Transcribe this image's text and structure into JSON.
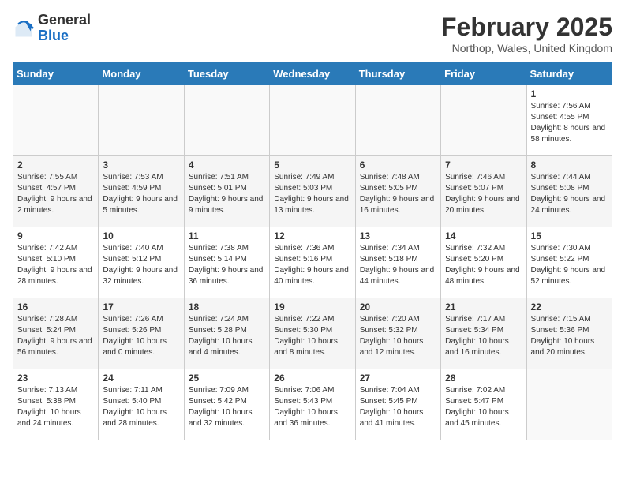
{
  "logo": {
    "general": "General",
    "blue": "Blue"
  },
  "title": "February 2025",
  "subtitle": "Northop, Wales, United Kingdom",
  "days_of_week": [
    "Sunday",
    "Monday",
    "Tuesday",
    "Wednesday",
    "Thursday",
    "Friday",
    "Saturday"
  ],
  "weeks": [
    [
      {
        "day": "",
        "info": ""
      },
      {
        "day": "",
        "info": ""
      },
      {
        "day": "",
        "info": ""
      },
      {
        "day": "",
        "info": ""
      },
      {
        "day": "",
        "info": ""
      },
      {
        "day": "",
        "info": ""
      },
      {
        "day": "1",
        "info": "Sunrise: 7:56 AM\nSunset: 4:55 PM\nDaylight: 8 hours and 58 minutes."
      }
    ],
    [
      {
        "day": "2",
        "info": "Sunrise: 7:55 AM\nSunset: 4:57 PM\nDaylight: 9 hours and 2 minutes."
      },
      {
        "day": "3",
        "info": "Sunrise: 7:53 AM\nSunset: 4:59 PM\nDaylight: 9 hours and 5 minutes."
      },
      {
        "day": "4",
        "info": "Sunrise: 7:51 AM\nSunset: 5:01 PM\nDaylight: 9 hours and 9 minutes."
      },
      {
        "day": "5",
        "info": "Sunrise: 7:49 AM\nSunset: 5:03 PM\nDaylight: 9 hours and 13 minutes."
      },
      {
        "day": "6",
        "info": "Sunrise: 7:48 AM\nSunset: 5:05 PM\nDaylight: 9 hours and 16 minutes."
      },
      {
        "day": "7",
        "info": "Sunrise: 7:46 AM\nSunset: 5:07 PM\nDaylight: 9 hours and 20 minutes."
      },
      {
        "day": "8",
        "info": "Sunrise: 7:44 AM\nSunset: 5:08 PM\nDaylight: 9 hours and 24 minutes."
      }
    ],
    [
      {
        "day": "9",
        "info": "Sunrise: 7:42 AM\nSunset: 5:10 PM\nDaylight: 9 hours and 28 minutes."
      },
      {
        "day": "10",
        "info": "Sunrise: 7:40 AM\nSunset: 5:12 PM\nDaylight: 9 hours and 32 minutes."
      },
      {
        "day": "11",
        "info": "Sunrise: 7:38 AM\nSunset: 5:14 PM\nDaylight: 9 hours and 36 minutes."
      },
      {
        "day": "12",
        "info": "Sunrise: 7:36 AM\nSunset: 5:16 PM\nDaylight: 9 hours and 40 minutes."
      },
      {
        "day": "13",
        "info": "Sunrise: 7:34 AM\nSunset: 5:18 PM\nDaylight: 9 hours and 44 minutes."
      },
      {
        "day": "14",
        "info": "Sunrise: 7:32 AM\nSunset: 5:20 PM\nDaylight: 9 hours and 48 minutes."
      },
      {
        "day": "15",
        "info": "Sunrise: 7:30 AM\nSunset: 5:22 PM\nDaylight: 9 hours and 52 minutes."
      }
    ],
    [
      {
        "day": "16",
        "info": "Sunrise: 7:28 AM\nSunset: 5:24 PM\nDaylight: 9 hours and 56 minutes."
      },
      {
        "day": "17",
        "info": "Sunrise: 7:26 AM\nSunset: 5:26 PM\nDaylight: 10 hours and 0 minutes."
      },
      {
        "day": "18",
        "info": "Sunrise: 7:24 AM\nSunset: 5:28 PM\nDaylight: 10 hours and 4 minutes."
      },
      {
        "day": "19",
        "info": "Sunrise: 7:22 AM\nSunset: 5:30 PM\nDaylight: 10 hours and 8 minutes."
      },
      {
        "day": "20",
        "info": "Sunrise: 7:20 AM\nSunset: 5:32 PM\nDaylight: 10 hours and 12 minutes."
      },
      {
        "day": "21",
        "info": "Sunrise: 7:17 AM\nSunset: 5:34 PM\nDaylight: 10 hours and 16 minutes."
      },
      {
        "day": "22",
        "info": "Sunrise: 7:15 AM\nSunset: 5:36 PM\nDaylight: 10 hours and 20 minutes."
      }
    ],
    [
      {
        "day": "23",
        "info": "Sunrise: 7:13 AM\nSunset: 5:38 PM\nDaylight: 10 hours and 24 minutes."
      },
      {
        "day": "24",
        "info": "Sunrise: 7:11 AM\nSunset: 5:40 PM\nDaylight: 10 hours and 28 minutes."
      },
      {
        "day": "25",
        "info": "Sunrise: 7:09 AM\nSunset: 5:42 PM\nDaylight: 10 hours and 32 minutes."
      },
      {
        "day": "26",
        "info": "Sunrise: 7:06 AM\nSunset: 5:43 PM\nDaylight: 10 hours and 36 minutes."
      },
      {
        "day": "27",
        "info": "Sunrise: 7:04 AM\nSunset: 5:45 PM\nDaylight: 10 hours and 41 minutes."
      },
      {
        "day": "28",
        "info": "Sunrise: 7:02 AM\nSunset: 5:47 PM\nDaylight: 10 hours and 45 minutes."
      },
      {
        "day": "",
        "info": ""
      }
    ]
  ]
}
